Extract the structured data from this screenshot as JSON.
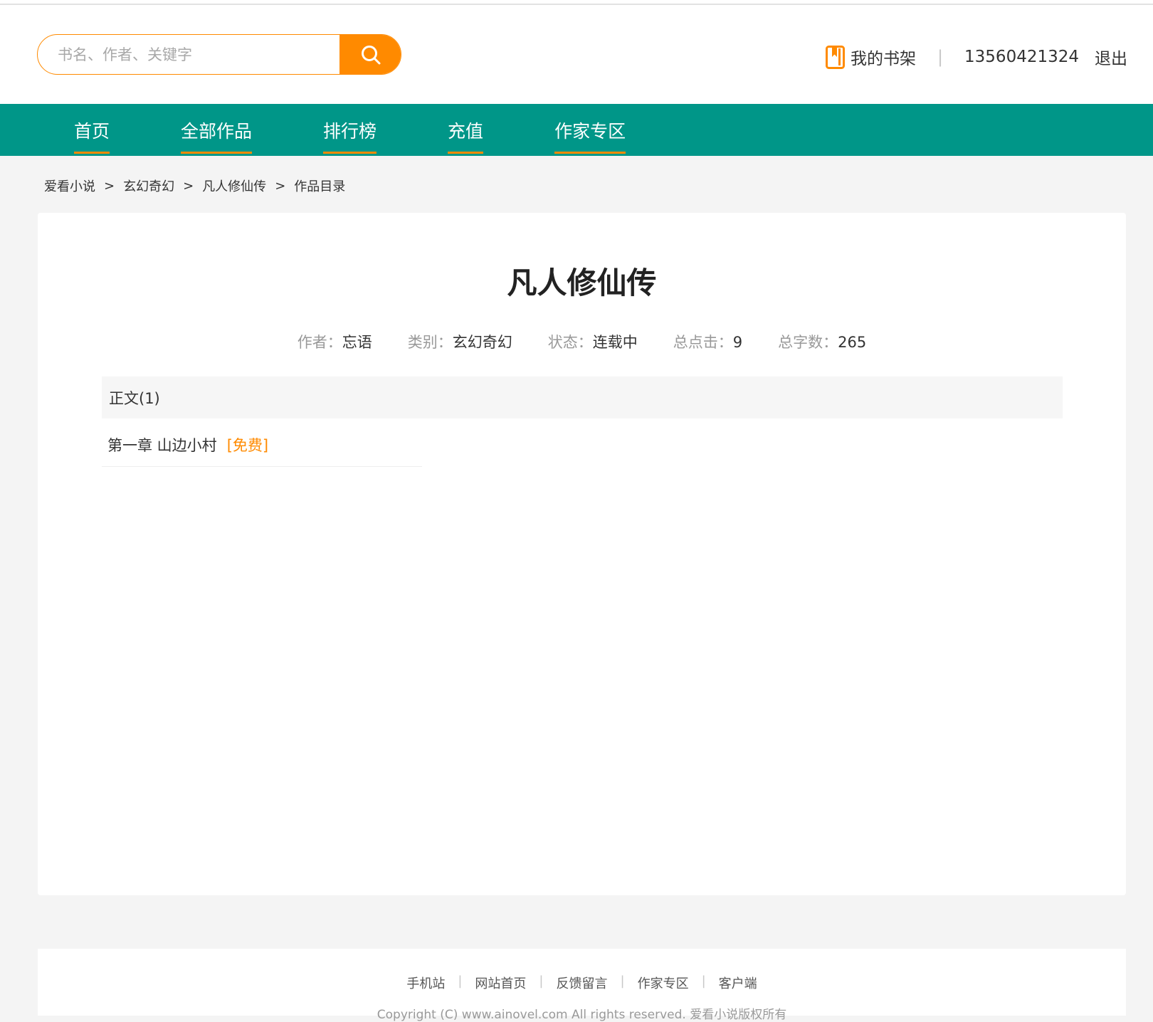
{
  "search": {
    "placeholder": "书名、作者、关键字"
  },
  "user": {
    "shelf_label": "我的书架",
    "phone": "13560421324",
    "logout_label": "退出"
  },
  "nav": {
    "items": [
      {
        "label": "首页"
      },
      {
        "label": "全部作品"
      },
      {
        "label": "排行榜"
      },
      {
        "label": "充值"
      },
      {
        "label": "作家专区"
      }
    ]
  },
  "breadcrumb": {
    "items": [
      "爱看小说",
      "玄幻奇幻",
      "凡人修仙传",
      "作品目录"
    ],
    "separator": ">"
  },
  "book": {
    "title": "凡人修仙传",
    "meta": [
      {
        "label": "作者：",
        "value": "忘语"
      },
      {
        "label": "类别：",
        "value": "玄幻奇幻"
      },
      {
        "label": "状态：",
        "value": "连载中"
      },
      {
        "label": "总点击：",
        "value": "9"
      },
      {
        "label": "总字数：",
        "value": "265"
      }
    ]
  },
  "volume": {
    "label": "正文(1)"
  },
  "chapters": [
    {
      "title": "第一章 山边小村",
      "tag": "[免费]"
    }
  ],
  "footer": {
    "links": [
      "手机站",
      "网站首页",
      "反馈留言",
      "作家专区",
      "客户端"
    ],
    "separator": "|",
    "copyright": "Copyright (C) www.ainovel.com All rights reserved. 爱看小说版权所有"
  },
  "colors": {
    "accent": "#ff8a00",
    "nav_bg": "#009688",
    "page_bg": "#f4f4f4"
  }
}
